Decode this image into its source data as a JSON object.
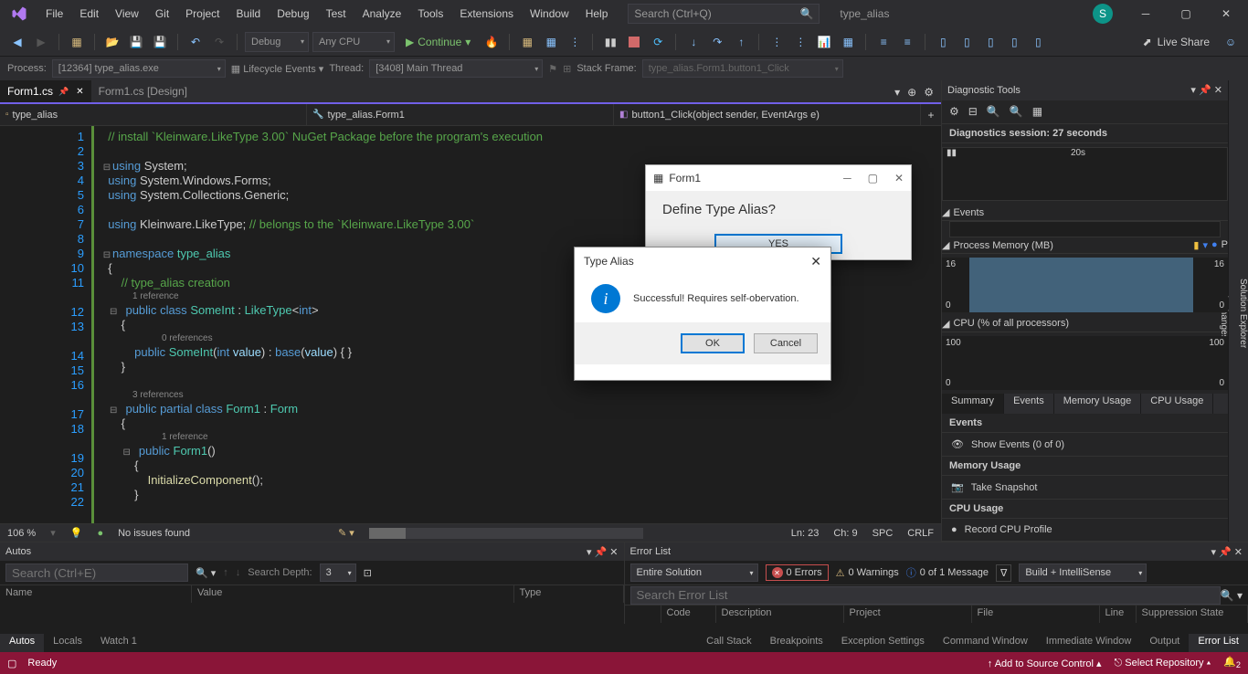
{
  "menubar": {
    "items": [
      "File",
      "Edit",
      "View",
      "Git",
      "Project",
      "Build",
      "Debug",
      "Test",
      "Analyze",
      "Tools",
      "Extensions",
      "Window",
      "Help"
    ],
    "search_placeholder": "Search (Ctrl+Q)",
    "solution_name": "type_alias",
    "user_initial": "S"
  },
  "toolbar": {
    "config": "Debug",
    "platform": "Any CPU",
    "continue": "Continue",
    "live_share": "Live Share"
  },
  "debugbar": {
    "process_label": "Process:",
    "process": "[12364] type_alias.exe",
    "lifecycle": "Lifecycle Events",
    "thread_label": "Thread:",
    "thread": "[3408] Main Thread",
    "stack_label": "Stack Frame:",
    "stack": "type_alias.Form1.button1_Click"
  },
  "tabs": {
    "active": "Form1.cs",
    "inactive": "Form1.cs [Design]"
  },
  "nav": {
    "project": "type_alias",
    "class": "type_alias.Form1",
    "member": "button1_Click(object sender, EventArgs e)"
  },
  "code": {
    "c1": "// install `Kleinware.LikeType 3.00` NuGet Package before the program's execution",
    "l3a": "using",
    "l3b": "System;",
    "l4a": "using",
    "l4b": "System.Windows.Forms;",
    "l5a": "using",
    "l5b": "System.Collections.Generic;",
    "l7a": "using",
    "l7b": "Kleinware.LikeType;",
    "l7c": "// belongs to the `Kleinware.LikeType 3.00`",
    "l9a": "namespace",
    "l9b": "type_alias",
    "c11": "// type_alias creation",
    "r1": "1 reference",
    "l12": "public class SomeInt : LikeType<int>",
    "r0": "0 references",
    "l14": "public SomeInt(int value) : base(value) { }",
    "r3": "3 references",
    "l17": "public partial class Form1 : Form",
    "r1b": "1 reference",
    "l19": "public Form1()",
    "l21": "InitializeComponent();"
  },
  "line_numbers": [
    "1",
    "2",
    "3",
    "4",
    "5",
    "6",
    "7",
    "8",
    "9",
    "10",
    "11",
    "",
    "12",
    "13",
    "",
    "14",
    "15",
    "16",
    "",
    "17",
    "18",
    "",
    "19",
    "20",
    "21",
    "22"
  ],
  "editor_status": {
    "zoom": "106 %",
    "issues": "No issues found",
    "ln": "Ln: 23",
    "ch": "Ch: 9",
    "spc": "SPC",
    "crlf": "CRLF"
  },
  "form1_window": {
    "title": "Form1",
    "question": "Define Type Alias?",
    "yes": "YES"
  },
  "dialog": {
    "title": "Type Alias",
    "message": "Successful! Requires self-obervation.",
    "ok": "OK",
    "cancel": "Cancel"
  },
  "diag": {
    "title": "Diagnostic Tools",
    "session": "Diagnostics session: 27 seconds",
    "timeline_mark": "20s",
    "events": "Events",
    "mem_title": "Process Memory (MB)",
    "mem_hi": "16",
    "mem_lo": "0",
    "cpu_title": "CPU (% of all processors)",
    "cpu_hi": "100",
    "cpu_lo": "0",
    "tabs": [
      "Summary",
      "Events",
      "Memory Usage",
      "CPU Usage"
    ],
    "sec_events": "Events",
    "show_events": "Show Events (0 of 0)",
    "sec_mem": "Memory Usage",
    "snapshot": "Take Snapshot",
    "sec_cpu": "CPU Usage",
    "record": "Record CPU Profile"
  },
  "right_rail": {
    "a": "Solution Explorer",
    "b": "Git Changes"
  },
  "autos": {
    "title": "Autos",
    "search_placeholder": "Search (Ctrl+E)",
    "depth_label": "Search Depth:",
    "depth": "3",
    "cols": [
      "Name",
      "Value",
      "Type"
    ]
  },
  "errlist": {
    "title": "Error List",
    "scope": "Entire Solution",
    "errors": "0 Errors",
    "warnings": "0 Warnings",
    "messages": "0 of 1 Message",
    "filter": "Build + IntelliSense",
    "search_placeholder": "Search Error List",
    "cols": [
      "",
      "Code",
      "Description",
      "Project",
      "File",
      "Line",
      "Suppression State"
    ]
  },
  "bottom_tabs": {
    "left": [
      "Autos",
      "Locals",
      "Watch 1"
    ],
    "right": [
      "Call Stack",
      "Breakpoints",
      "Exception Settings",
      "Command Window",
      "Immediate Window",
      "Output",
      "Error List"
    ]
  },
  "statusbar": {
    "ready": "Ready",
    "add_source": "Add to Source Control",
    "repo": "Select Repository",
    "notifications": "2"
  }
}
